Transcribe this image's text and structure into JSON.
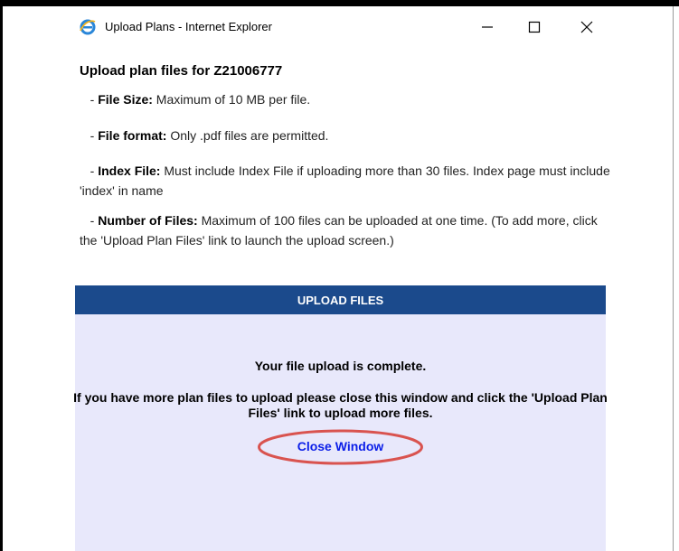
{
  "window": {
    "title": "Upload Plans - Internet Explorer",
    "icon": "internet-explorer-icon",
    "controls": [
      "minimize-icon",
      "maximize-icon",
      "close-icon"
    ]
  },
  "page": {
    "heading": "Upload plan files for Z21006777",
    "rules": [
      {
        "prefix": "- ",
        "label": "File Size:",
        "text": " Maximum of 10 MB per file."
      },
      {
        "prefix": "- ",
        "label": "File format:",
        "text": " Only .pdf files are permitted."
      },
      {
        "prefix": "- ",
        "label": "Index File:",
        "text": " Must include Index File if uploading more than 30 files. Index page must include 'index' in name"
      },
      {
        "prefix": "- ",
        "label": "Number of Files:",
        "text": " Maximum of 100 files can be uploaded at one time. (To add more, click the 'Upload Plan Files' link to launch the upload screen.)"
      }
    ]
  },
  "upload_panel": {
    "header": "UPLOAD FILES",
    "complete_message": "Your file upload is complete.",
    "more_message": "If you have more plan files to upload please close this window and click the 'Upload Plan Files' link to upload more files.",
    "close_link": "Close Window"
  },
  "colors": {
    "header_bg": "#1b4a8c",
    "panel_bg": "#e8e8fb",
    "link": "#0b1ee8",
    "annotation_ring": "#d9534f"
  }
}
